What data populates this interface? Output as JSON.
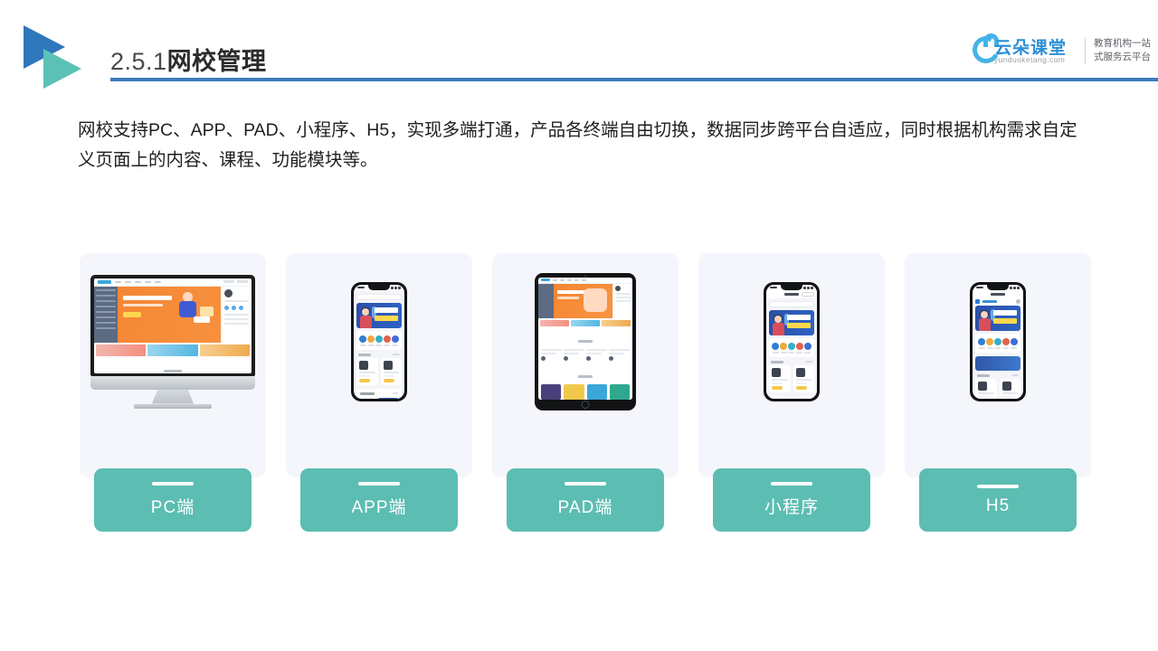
{
  "header": {
    "section_number": "2.5.1",
    "title": "网校管理",
    "logo_icon": "double-triangle-play-icon"
  },
  "brand": {
    "name_cn": "云朵课堂",
    "url": "yunduoketang.com",
    "tagline_line1": "教育机构一站",
    "tagline_line2": "式服务云平台",
    "icon": "cloud-icon",
    "accent_color": "#2b8fd6"
  },
  "intro": {
    "text": "网校支持PC、APP、PAD、小程序、H5，实现多端打通，产品各终端自由切换，数据同步跨平台自适应，同时根据机构需求自定义页面上的内容、课程、功能模块等。"
  },
  "cards": [
    {
      "label": "PC端",
      "device": "desktop-monitor"
    },
    {
      "label": "APP端",
      "device": "smartphone"
    },
    {
      "label": "PAD端",
      "device": "tablet"
    },
    {
      "label": "小程序",
      "device": "smartphone-miniprogram"
    },
    {
      "label": "H5",
      "device": "smartphone-browser"
    }
  ],
  "colors": {
    "label_teal": "#5cbdb2",
    "card_bg": "#f4f6fb",
    "rule_blue": "#3b7cc0",
    "logo_blue": "#2f77bb",
    "logo_teal": "#5bc1b6"
  }
}
